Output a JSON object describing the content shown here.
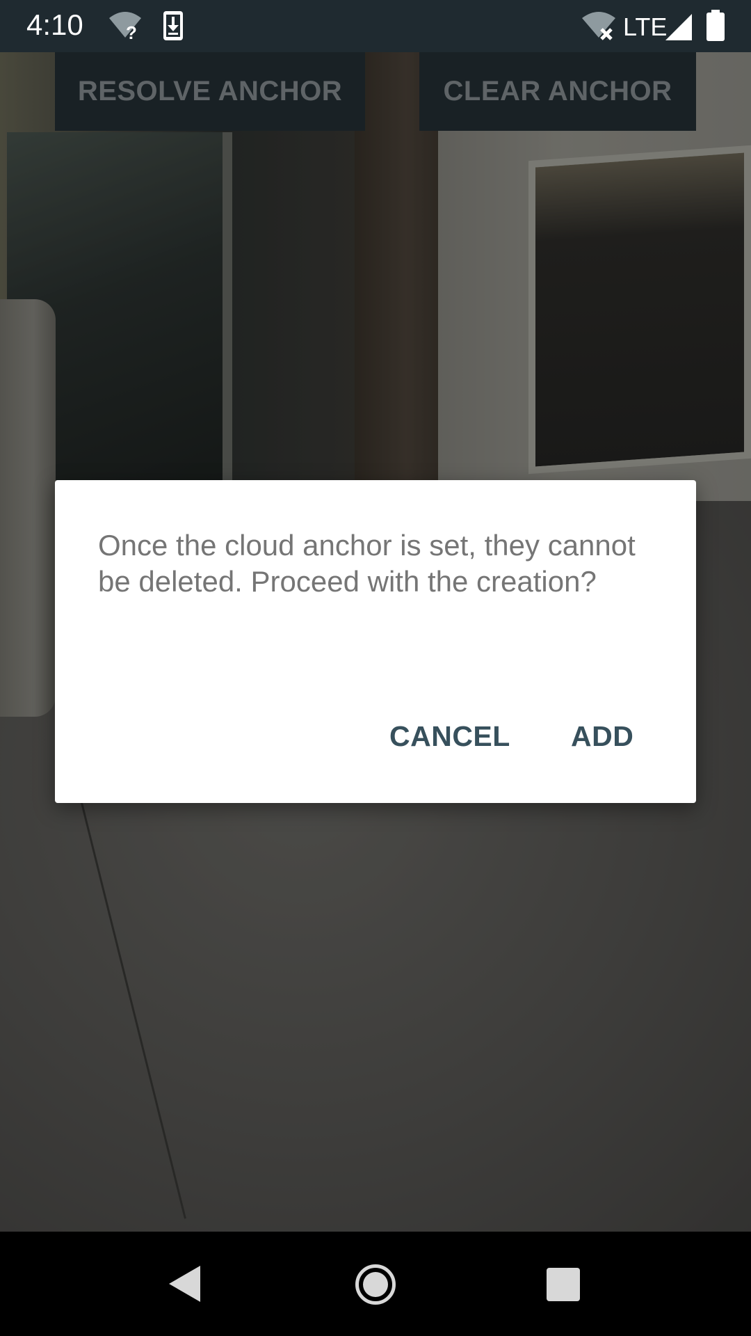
{
  "status_bar": {
    "time": "4:10",
    "network_label": "LTE",
    "icons": [
      "wifi-unknown-icon",
      "download-icon",
      "wifi-off-icon",
      "cell-signal-icon",
      "battery-icon"
    ]
  },
  "toolbar": {
    "resolve_label": "RESOLVE ANCHOR",
    "clear_label": "CLEAR ANCHOR"
  },
  "dialog": {
    "message": "Once the cloud anchor is set, they cannot be deleted. Proceed with the creation?",
    "cancel_label": "CANCEL",
    "add_label": "ADD",
    "accent_color": "#37505c"
  },
  "navigation": {
    "icons": [
      "back-icon",
      "home-icon",
      "recents-icon"
    ]
  }
}
